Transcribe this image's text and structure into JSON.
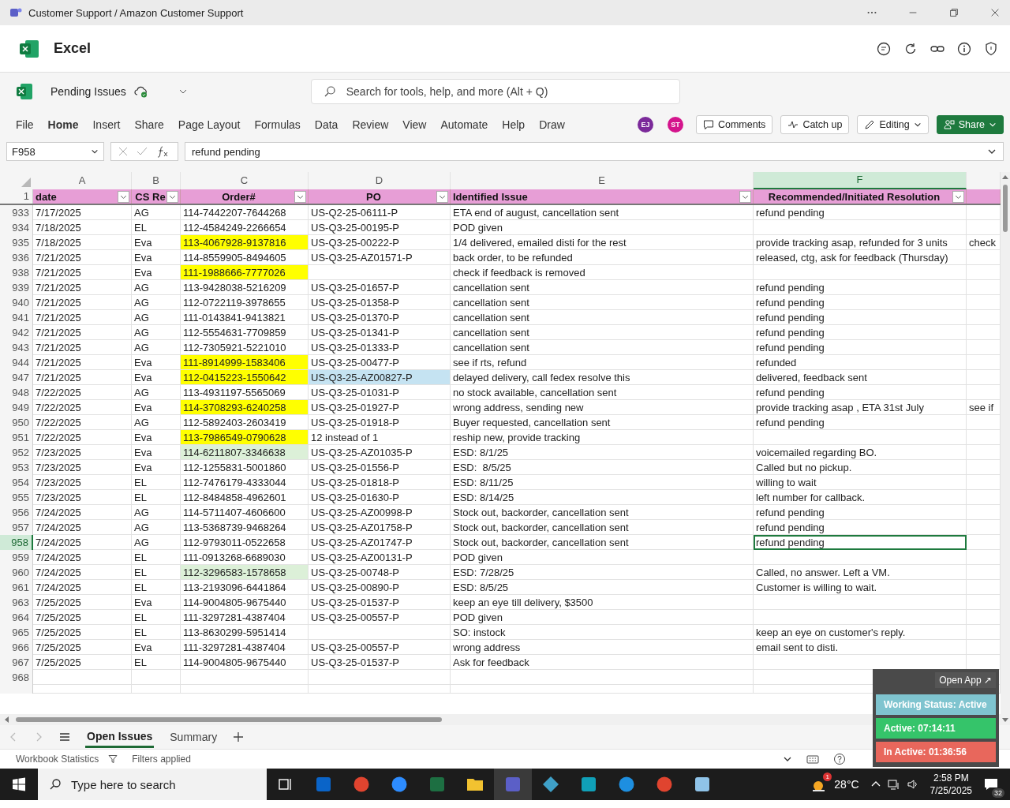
{
  "window": {
    "title": "Customer Support / Amazon Customer Support"
  },
  "app": {
    "name": "Excel"
  },
  "document": {
    "name": "Pending Issues"
  },
  "search": {
    "placeholder": "Search for tools, help, and more (Alt + Q)"
  },
  "menu": [
    {
      "label": "File",
      "selected": false
    },
    {
      "label": "Home",
      "selected": true
    },
    {
      "label": "Insert",
      "selected": false
    },
    {
      "label": "Share",
      "selected": false
    },
    {
      "label": "Page Layout",
      "selected": false
    },
    {
      "label": "Formulas",
      "selected": false
    },
    {
      "label": "Data",
      "selected": false
    },
    {
      "label": "Review",
      "selected": false
    },
    {
      "label": "View",
      "selected": false
    },
    {
      "label": "Automate",
      "selected": false
    },
    {
      "label": "Help",
      "selected": false
    },
    {
      "label": "Draw",
      "selected": false
    }
  ],
  "collaborators": [
    {
      "initials": "EJ",
      "color": "#7b2a9a"
    },
    {
      "initials": "ST",
      "color": "#d4148c"
    }
  ],
  "actions": [
    {
      "label": "Comments",
      "kind": "comments"
    },
    {
      "label": "Catch up",
      "kind": "catchup"
    },
    {
      "label": "Editing",
      "kind": "editing"
    },
    {
      "label": "Share",
      "kind": "share"
    }
  ],
  "formula_bar": {
    "name_box": "F958",
    "formula": "refund pending"
  },
  "columns": [
    {
      "letter": "A",
      "header": "date",
      "selected": false
    },
    {
      "letter": "B",
      "header": "CS Re",
      "selected": false
    },
    {
      "letter": "C",
      "header": "Order#",
      "selected": false
    },
    {
      "letter": "D",
      "header": "PO",
      "selected": false
    },
    {
      "letter": "E",
      "header": "Identified Issue",
      "selected": false
    },
    {
      "letter": "F",
      "header": "Recommended/Initiated Resolution",
      "selected": true
    }
  ],
  "header_row": "1",
  "rows": [
    {
      "number": "933",
      "selected": false,
      "date": "7/17/2025",
      "rep": "AG",
      "order": "114-7442207-7644268",
      "po": "US-Q2-25-06111-P",
      "issue": "ETA end of august, cancellation sent",
      "resolution": "refund pending"
    },
    {
      "number": "934",
      "selected": false,
      "date": "7/18/2025",
      "rep": "EL",
      "order": "112-4584249-2266654",
      "po": "US-Q3-25-00195-P",
      "issue": "POD given"
    },
    {
      "number": "935",
      "selected": false,
      "date": "7/18/2025",
      "rep": "Eva",
      "order": {
        "text": "113-4067928-9137816",
        "color": "#ffff00"
      },
      "po": "US-Q3-25-00222-P",
      "issue": "1/4 delivered, emailed disti for the rest",
      "resolution": "provide tracking asap, refunded for 3 units",
      "column_g": "check"
    },
    {
      "number": "936",
      "selected": false,
      "date": "7/21/2025",
      "rep": "Eva",
      "order": "114-8559905-8494605",
      "po": "US-Q3-25-AZ01571-P",
      "issue": "back order, to be refunded",
      "resolution": "released, ctg, ask for feedback (Thursday)"
    },
    {
      "number": "938",
      "selected": false,
      "date": "7/21/2025",
      "rep": "Eva",
      "order": {
        "text": "111-1988666-7777026",
        "color": "#ffff00"
      },
      "issue": "check if feedback is removed"
    },
    {
      "number": "939",
      "selected": false,
      "date": "7/21/2025",
      "rep": "AG",
      "order": "113-9428038-5216209",
      "po": "US-Q3-25-01657-P",
      "issue": "cancellation sent",
      "resolution": "refund pending"
    },
    {
      "number": "940",
      "selected": false,
      "date": "7/21/2025",
      "rep": "AG",
      "order": "112-0722119-3978655",
      "po": "US-Q3-25-01358-P",
      "issue": "cancellation sent",
      "resolution": "refund pending"
    },
    {
      "number": "941",
      "selected": false,
      "date": "7/21/2025",
      "rep": "AG",
      "order": "111-0143841-9413821",
      "po": "US-Q3-25-01370-P",
      "issue": "cancellation sent",
      "resolution": "refund pending"
    },
    {
      "number": "942",
      "selected": false,
      "date": "7/21/2025",
      "rep": "AG",
      "order": "112-5554631-7709859",
      "po": "US-Q3-25-01341-P",
      "issue": "cancellation sent",
      "resolution": "refund pending"
    },
    {
      "number": "943",
      "selected": false,
      "date": "7/21/2025",
      "rep": "AG",
      "order": "112-7305921-5221010",
      "po": "US-Q3-25-01333-P",
      "issue": "cancellation sent",
      "resolution": "refund pending"
    },
    {
      "number": "944",
      "selected": false,
      "date": "7/21/2025",
      "rep": "Eva",
      "order": {
        "text": "111-8914999-1583406",
        "color": "#ffff00"
      },
      "po": "US-Q3-25-00477-P",
      "issue": "see if rts, refund",
      "resolution": "refunded"
    },
    {
      "number": "947",
      "selected": false,
      "date": "7/21/2025",
      "rep": "Eva",
      "order": {
        "text": "112-0415223-1550642",
        "color": "#ffff00"
      },
      "po": {
        "text": "US-Q3-25-AZ00827-P",
        "color": "#c5e3f2"
      },
      "issue": "delayed delivery, call fedex resolve this",
      "resolution": "delivered, feedback sent"
    },
    {
      "number": "948",
      "selected": false,
      "date": "7/22/2025",
      "rep": "AG",
      "order": "113-4931197-5565069",
      "po": "US-Q3-25-01031-P",
      "issue": "no stock available, cancellation sent",
      "resolution": "refund pending"
    },
    {
      "number": "949",
      "selected": false,
      "date": "7/22/2025",
      "rep": "Eva",
      "order": {
        "text": "114-3708293-6240258",
        "color": "#ffff00"
      },
      "po": "US-Q3-25-01927-P",
      "issue": "wrong address, sending new",
      "resolution": "provide tracking asap , ETA 31st July",
      "column_g": "see if"
    },
    {
      "number": "950",
      "selected": false,
      "date": "7/22/2025",
      "rep": "AG",
      "order": "112-5892403-2603419",
      "po": "US-Q3-25-01918-P",
      "issue": "Buyer requested, cancellation sent",
      "resolution": "refund pending"
    },
    {
      "number": "951",
      "selected": false,
      "date": "7/22/2025",
      "rep": "Eva",
      "order": {
        "text": "113-7986549-0790628",
        "color": "#ffff00"
      },
      "po": "12 instead of 1",
      "issue": "reship new, provide tracking"
    },
    {
      "number": "952",
      "selected": false,
      "date": "7/23/2025",
      "rep": "Eva",
      "order": {
        "text": "114-6211807-3346638",
        "color": "#dcf0d8"
      },
      "po": "US-Q3-25-AZ01035-P",
      "issue": "ESD: 8/1/25",
      "resolution": "voicemailed regarding BO."
    },
    {
      "number": "953",
      "selected": false,
      "date": "7/23/2025",
      "rep": "Eva",
      "order": "112-1255831-5001860",
      "po": "US-Q3-25-01556-P",
      "issue": "ESD:  8/5/25",
      "resolution": "Called but no pickup."
    },
    {
      "number": "954",
      "selected": false,
      "date": "7/23/2025",
      "rep": "EL",
      "order": "112-7476179-4333044",
      "po": "US-Q3-25-01818-P",
      "issue": "ESD: 8/11/25",
      "resolution": "willing to wait"
    },
    {
      "number": "955",
      "selected": false,
      "date": "7/23/2025",
      "rep": "EL",
      "order": "112-8484858-4962601",
      "po": "US-Q3-25-01630-P",
      "issue": "ESD: 8/14/25",
      "resolution": "left number for callback."
    },
    {
      "number": "956",
      "selected": false,
      "date": "7/24/2025",
      "rep": "AG",
      "order": "114-5711407-4606600",
      "po": "US-Q3-25-AZ00998-P",
      "issue": "Stock out, backorder, cancellation sent",
      "resolution": "refund pending"
    },
    {
      "number": "957",
      "selected": false,
      "date": "7/24/2025",
      "rep": "AG",
      "order": "113-5368739-9468264",
      "po": "US-Q3-25-AZ01758-P",
      "issue": "Stock out, backorder, cancellation sent",
      "resolution": "refund pending"
    },
    {
      "number": "958",
      "selected": true,
      "date": "7/24/2025",
      "rep": "AG",
      "order": "112-9793011-0522658",
      "po": "US-Q3-25-AZ01747-P",
      "issue": "Stock out, backorder, cancellation sent",
      "resolution": "refund pending"
    },
    {
      "number": "959",
      "selected": false,
      "date": "7/24/2025",
      "rep": "EL",
      "order": "111-0913268-6689030",
      "po": "US-Q3-25-AZ00131-P",
      "issue": "POD given"
    },
    {
      "number": "960",
      "selected": false,
      "date": "7/24/2025",
      "rep": "EL",
      "order": {
        "text": "112-3296583-1578658",
        "color": "#dcf0d8"
      },
      "po": "US-Q3-25-00748-P",
      "issue": "ESD: 7/28/25",
      "resolution": "Called, no answer. Left a VM."
    },
    {
      "number": "961",
      "selected": false,
      "date": "7/24/2025",
      "rep": "EL",
      "order": "113-2193096-6441864",
      "po": "US-Q3-25-00890-P",
      "issue": "ESD: 8/5/25",
      "resolution": "Customer is willing to wait."
    },
    {
      "number": "963",
      "selected": false,
      "date": "7/25/2025",
      "rep": "Eva",
      "order": "114-9004805-9675440",
      "po": "US-Q3-25-01537-P",
      "issue": "keep an eye till delivery, $3500"
    },
    {
      "number": "964",
      "selected": false,
      "date": "7/25/2025",
      "rep": "EL",
      "order": "111-3297281-4387404",
      "po": "US-Q3-25-00557-P",
      "issue": "POD given"
    },
    {
      "number": "965",
      "selected": false,
      "date": "7/25/2025",
      "rep": "EL",
      "order": "113-8630299-5951414",
      "issue": "SO: instock",
      "resolution": "keep an eye on customer's reply."
    },
    {
      "number": "966",
      "selected": false,
      "date": "7/25/2025",
      "rep": "Eva",
      "order": "111-3297281-4387404",
      "po": "US-Q3-25-00557-P",
      "issue": "wrong address",
      "resolution": "email sent to disti."
    },
    {
      "number": "967",
      "selected": false,
      "date": "7/25/2025",
      "rep": "EL",
      "order": "114-9004805-9675440",
      "po": "US-Q3-25-01537-P",
      "issue": "Ask for feedback"
    },
    {
      "number": "968",
      "selected": false
    }
  ],
  "sheet_tabs": [
    {
      "label": "Open Issues",
      "selected": true
    },
    {
      "label": "Summary",
      "selected": false
    }
  ],
  "status_bar": {
    "statistics": "Workbook Statistics",
    "filters": "Filters applied"
  },
  "tracker": {
    "open_label": "Open App ↗",
    "status": "Working Status: Active",
    "active": "Active: 07:14:11",
    "inactive": "In Active: 01:36:56"
  },
  "taskbar": {
    "search_placeholder": "Type here to search",
    "temperature": "28°C",
    "weather_alerts": "1",
    "time": "2:58 PM",
    "date": "7/25/2025",
    "notifications": "32"
  }
}
